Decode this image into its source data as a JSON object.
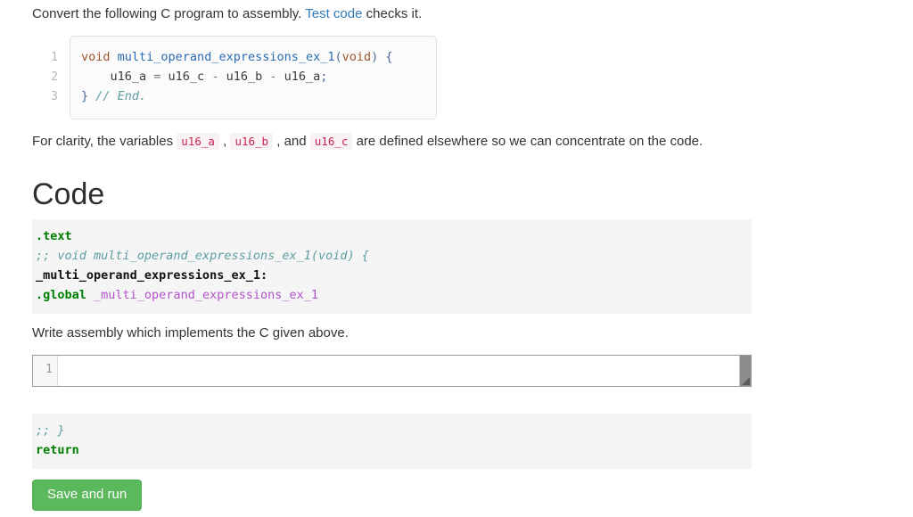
{
  "intro": {
    "before_link": "Convert the following C program to assembly. ",
    "link_text": "Test code",
    "after_link": " checks it."
  },
  "c_listing": {
    "line_numbers": [
      "1",
      "2",
      "3"
    ],
    "line1": {
      "kw": "void",
      "space": " ",
      "fn": "multi_operand_expressions_ex_1",
      "punc_open": "(",
      "kw2": "void",
      "punc_close": ")",
      "brace": " {"
    },
    "line2": {
      "indent": "    ",
      "a": "u16_a",
      "eq": " = ",
      "c": "u16_c",
      "minus1": " - ",
      "b": "u16_b",
      "minus2": " - ",
      "a2": "u16_a",
      "semi": ";"
    },
    "line3": {
      "brace": "}",
      "comment": " // End."
    }
  },
  "clarity": {
    "part1": "For clarity, the variables ",
    "var_a": "u16_a",
    "sep1": " , ",
    "var_b": "u16_b",
    "sep2": " , and ",
    "var_c": "u16_c",
    "part2": " are defined elsewhere so we can concentrate on the code."
  },
  "code_heading": "Code",
  "asm_prefix": {
    "line1_dir": ".text",
    "line2_comment": ";; void multi_operand_expressions_ex_1(void) {",
    "line3_label": "_multi_operand_expressions_ex_1:",
    "line4_dir": ".global",
    "line4_sym": " _multi_operand_expressions_ex_1"
  },
  "instruction": "Write assembly which implements the C given above.",
  "editor": {
    "line_number": "1",
    "value": "",
    "placeholder": ""
  },
  "asm_suffix": {
    "line1_comment": ";; }",
    "line2_kw": "return"
  },
  "save_button": "Save and run",
  "colors": {
    "link": "#337ab7",
    "inline_code_text": "#c7254e",
    "inline_code_bg": "#f9f2f4",
    "asm_block_bg": "#f5f5f5",
    "directive_green": "#008000",
    "comment_teal": "#5f9ea0",
    "symbol_purple": "#b452cd",
    "button_green": "#5cb85c",
    "button_border": "#4cae4c",
    "c_keyword": "#a0522d",
    "c_function": "#2b6cb0"
  }
}
